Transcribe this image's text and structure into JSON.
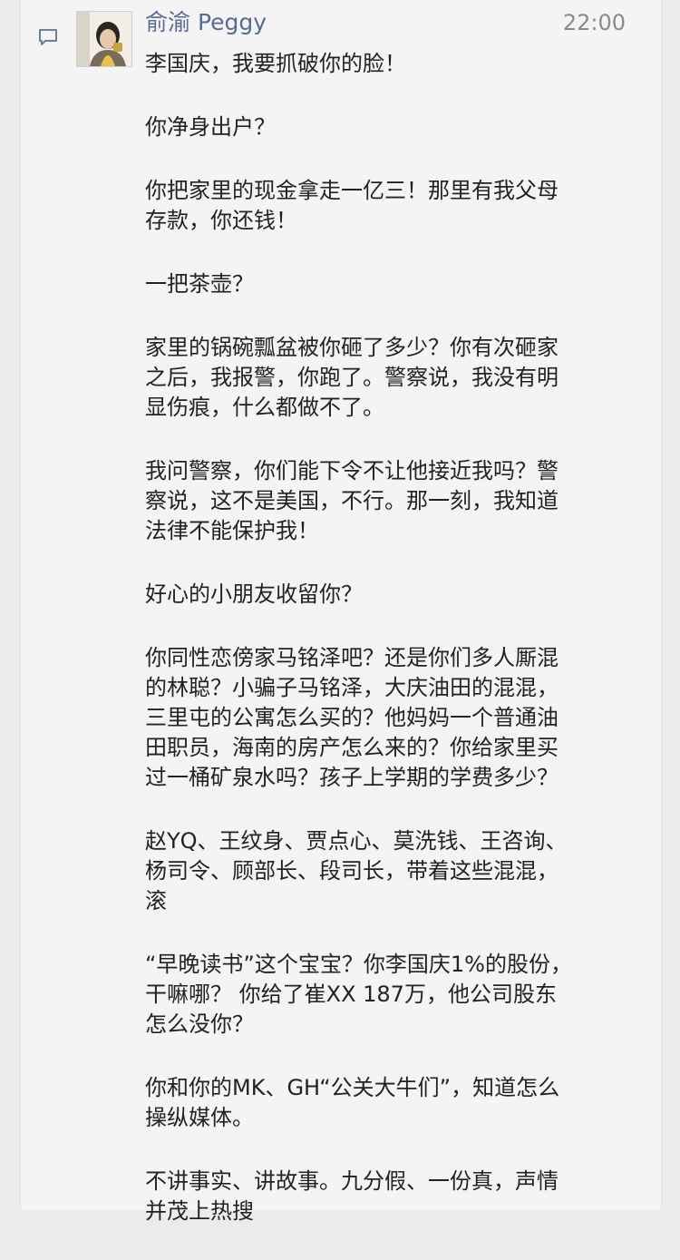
{
  "post": {
    "author": "俞渝 Peggy",
    "time": "22:00",
    "paragraphs": [
      "李国庆，我要抓破你的脸！",
      "你净身出户？",
      "你把家里的现金拿走一亿三！那里有我父母\n存款，你还钱！",
      "一把茶壶？",
      "家里的锅碗瓢盆被你砸了多少？你有次砸家\n之后，我报警，你跑了。警察说，我没有明\n显伤痕，什么都做不了。",
      "我问警察，你们能下令不让他接近我吗？警\n察说，这不是美国，不行。那一刻，我知道\n法律不能保护我！",
      "好心的小朋友收留你？",
      "你同性恋傍家马铭泽吧？还是你们多人厮混\n的林聪？小骗子马铭泽，大庆油田的混混，\n三里屯的公寓怎么买的？他妈妈一个普通油\n田职员，海南的房产怎么来的？你给家里买\n过一桶矿泉水吗？孩子上学期的学费多少？",
      "赵YQ、王纹身、贾点心、莫洗钱、王咨询、\n杨司令、顾部长、段司长，带着这些混混，\n滚",
      "“早晚读书”这个宝宝？你李国庆1%的股份，\n干嘛哪？ 你给了崔XX 187万，他公司股东\n怎么没你？",
      "你和你的MK、GH“公关大牛们”，知道怎么\n操纵媒体。",
      "不讲事实、讲故事。九分假、一份真，声情\n并茂上热搜"
    ]
  },
  "icons": {
    "comment": "comment-icon",
    "avatar": "avatar"
  },
  "colors": {
    "author_link": "#576b95",
    "time": "#8a8a8a",
    "text": "#222222",
    "background": "#f4f4f4"
  }
}
